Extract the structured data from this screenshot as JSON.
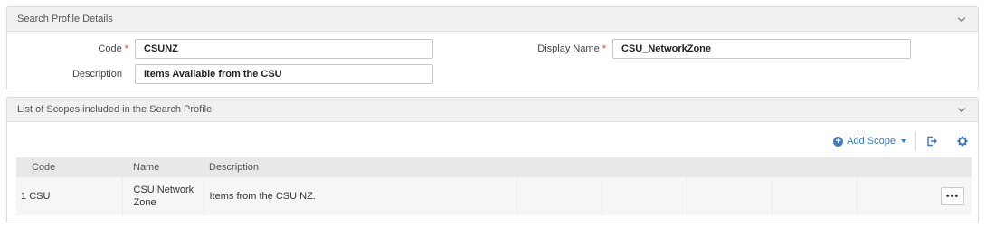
{
  "details_panel": {
    "title": "Search Profile Details",
    "code_label": "Code",
    "code_value": "CSUNZ",
    "description_label": "Description",
    "description_value": "Items Available from the CSU",
    "display_name_label": "Display Name",
    "display_name_value": "CSU_NetworkZone",
    "required_marker": "*"
  },
  "scopes_panel": {
    "title": "List of Scopes included in the Search Profile",
    "add_scope_label": "Add Scope",
    "columns": [
      "Code",
      "Name",
      "Description"
    ],
    "rows": [
      {
        "index": "1",
        "code": "CSU",
        "name": "CSU Network Zone",
        "description": "Items from the CSU NZ.",
        "actions_label": "•••"
      }
    ]
  },
  "colors": {
    "accent": "#3e79c3",
    "required": "#e03a3a",
    "header_bg": "#f0f0f0"
  },
  "icons": [
    "chevron-down-icon",
    "plus-circle-icon",
    "export-icon",
    "gear-icon"
  ]
}
